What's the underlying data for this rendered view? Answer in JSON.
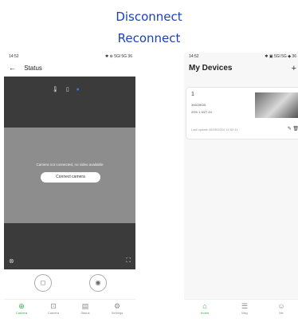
{
  "captions": {
    "line1": "Disconnect",
    "line2": "Reconnect"
  },
  "left_phone": {
    "status_bar": {
      "time": "14:52",
      "icons": "✱ ⊕ 5Gl 5G 36"
    },
    "header": {
      "back": "←",
      "title": "Status"
    },
    "video": {
      "top_icons": [
        "🌡",
        "▯",
        "●"
      ],
      "message": "Camera not connected, no video available",
      "connect_button": "Connect camera",
      "bottom_left_icon": "⊗",
      "bottom_right_icon": "⛶"
    },
    "controls": {
      "left": "◻",
      "right": "◉"
    },
    "tabs": [
      {
        "icon": "⊕",
        "label": "Camera"
      },
      {
        "icon": "⊡",
        "label": "Camera"
      },
      {
        "icon": "▤",
        "label": "Status"
      },
      {
        "icon": "⚙",
        "label": "Settings"
      }
    ]
  },
  "right_phone": {
    "status_bar": {
      "time": "14:52",
      "icons": "✱ ▣ 5Gl 5G ◆ 36"
    },
    "header": {
      "title": "My Devices",
      "add": "+"
    },
    "device": {
      "name": "1",
      "storage": "346/28GB",
      "battery": "29%   1.9/27.4V",
      "updated": "Last update 06/05/2024 14:52:41",
      "actions": "✎ 🗑"
    },
    "tabs": [
      {
        "icon": "⌂",
        "label": "Home"
      },
      {
        "icon": "☰",
        "label": "Msg"
      },
      {
        "icon": "☺",
        "label": "Me"
      }
    ]
  },
  "colors": {
    "caption": "#1a3fc4",
    "accent": "#3aaa55",
    "video_bg": "#3b3b3b"
  }
}
